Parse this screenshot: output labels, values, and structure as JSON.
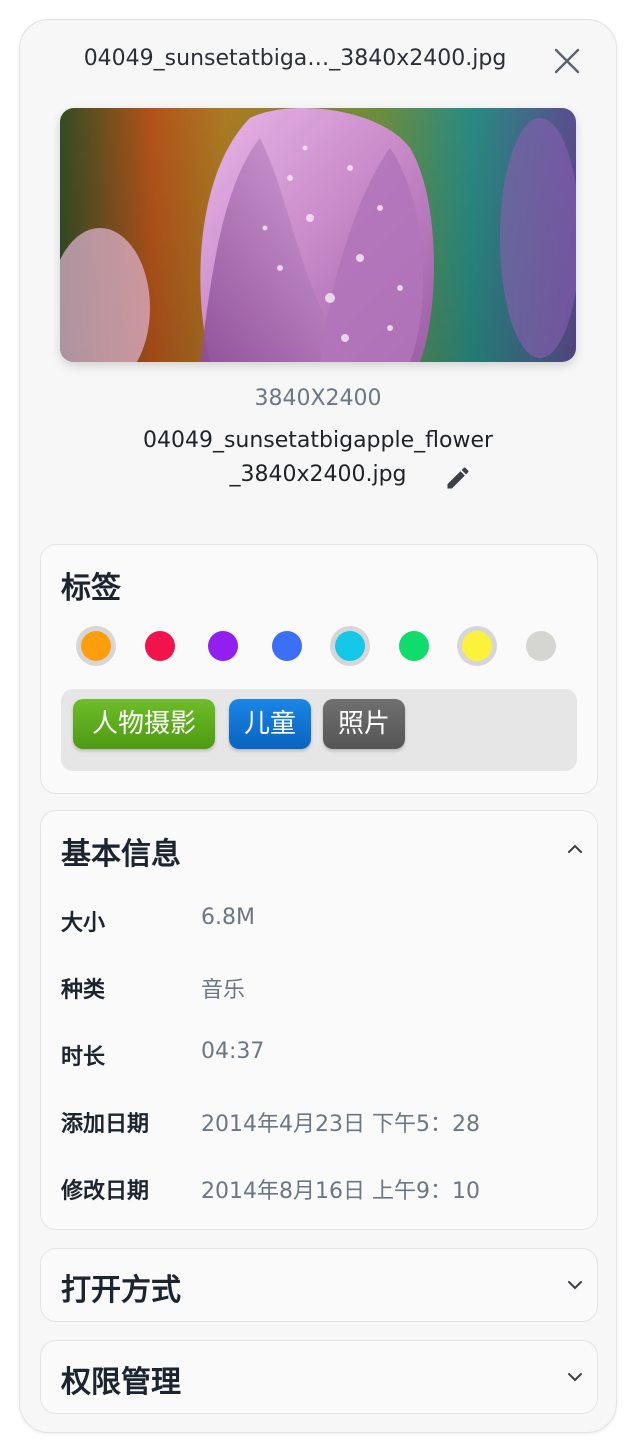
{
  "header": {
    "title": "04049_sunsetatbiga…_3840x2400.jpg"
  },
  "file": {
    "dimensions": "3840X2400",
    "name_line1": "04049_sunsetatbigapple_flower",
    "name_line2": "_3840x2400.jpg"
  },
  "tags_section": {
    "title": "标签",
    "colors": [
      {
        "hex": "#ff9e0d",
        "selected": true
      },
      {
        "hex": "#f2134d",
        "selected": false
      },
      {
        "hex": "#9120ee",
        "selected": false
      },
      {
        "hex": "#3b6ff5",
        "selected": false
      },
      {
        "hex": "#16c8e8",
        "selected": true
      },
      {
        "hex": "#0fdc6a",
        "selected": false
      },
      {
        "hex": "#fdf23a",
        "selected": true
      },
      {
        "hex": "#d5d5d2",
        "selected": false
      }
    ],
    "tags": [
      {
        "label": "人物摄影",
        "color": "#55a617"
      },
      {
        "label": "儿童",
        "color": "#0d6fd1"
      },
      {
        "label": "照片",
        "color": "#5e5e5e"
      }
    ]
  },
  "basic_info": {
    "title": "基本信息",
    "rows": [
      {
        "label": "大小",
        "value": "6.8M"
      },
      {
        "label": "种类",
        "value": "音乐"
      },
      {
        "label": "时长",
        "value": "04:37"
      },
      {
        "label": "添加日期",
        "value": "2014年4月23日 下午5：28"
      },
      {
        "label": "修改日期",
        "value": "2014年8月16日 上午9：10"
      }
    ]
  },
  "open_with": {
    "title": "打开方式"
  },
  "permissions": {
    "title": "权限管理"
  }
}
